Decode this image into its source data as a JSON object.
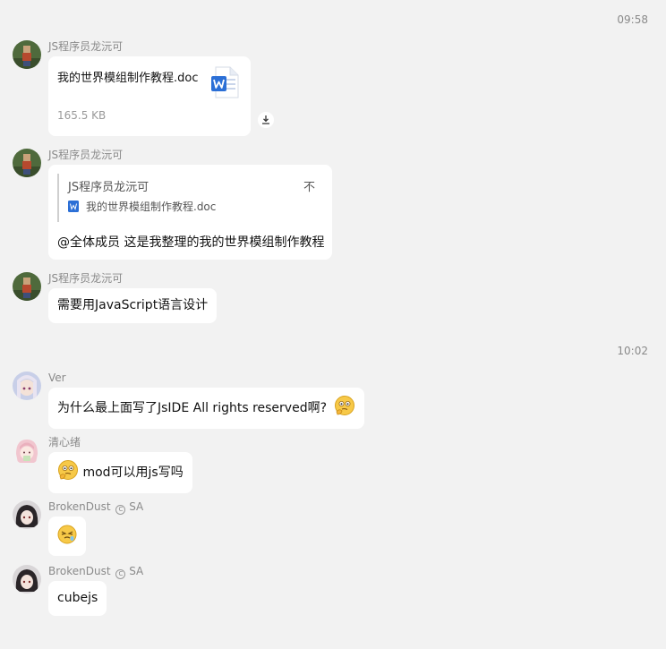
{
  "timestamps": [
    "09:58",
    "10:02"
  ],
  "messages": [
    {
      "sender": "JS程序员龙沅可",
      "type": "file",
      "file": {
        "name": "我的世界模组制作教程.doc",
        "size": "165.5 KB",
        "icon": "word-doc-icon"
      },
      "download_icon": "download-icon"
    },
    {
      "sender": "JS程序员龙沅可",
      "type": "reply",
      "quote": {
        "sender": "JS程序员龙沅可",
        "file_name": "我的世界模组制作教程.doc",
        "pin_glyph": "不"
      },
      "text": "@全体成员 这是我整理的我的世界模组制作教程"
    },
    {
      "sender": "JS程序员龙沅可",
      "type": "text",
      "text": "需要用JavaScript语言设计"
    },
    {
      "sender": "Ver",
      "type": "text",
      "text": "为什么最上面写了JsIDE All rights reserved啊?",
      "emoji": "thinking-face-emoji"
    },
    {
      "sender": "清心绪",
      "type": "text",
      "text": "mod可以用js写吗",
      "emoji": "thinking-face-emoji"
    },
    {
      "sender": "BrokenDust",
      "badge": "SA",
      "type": "emoji",
      "emoji": "tired-face-emoji"
    },
    {
      "sender": "BrokenDust",
      "badge": "SA",
      "type": "text",
      "text": "cubejs"
    }
  ]
}
